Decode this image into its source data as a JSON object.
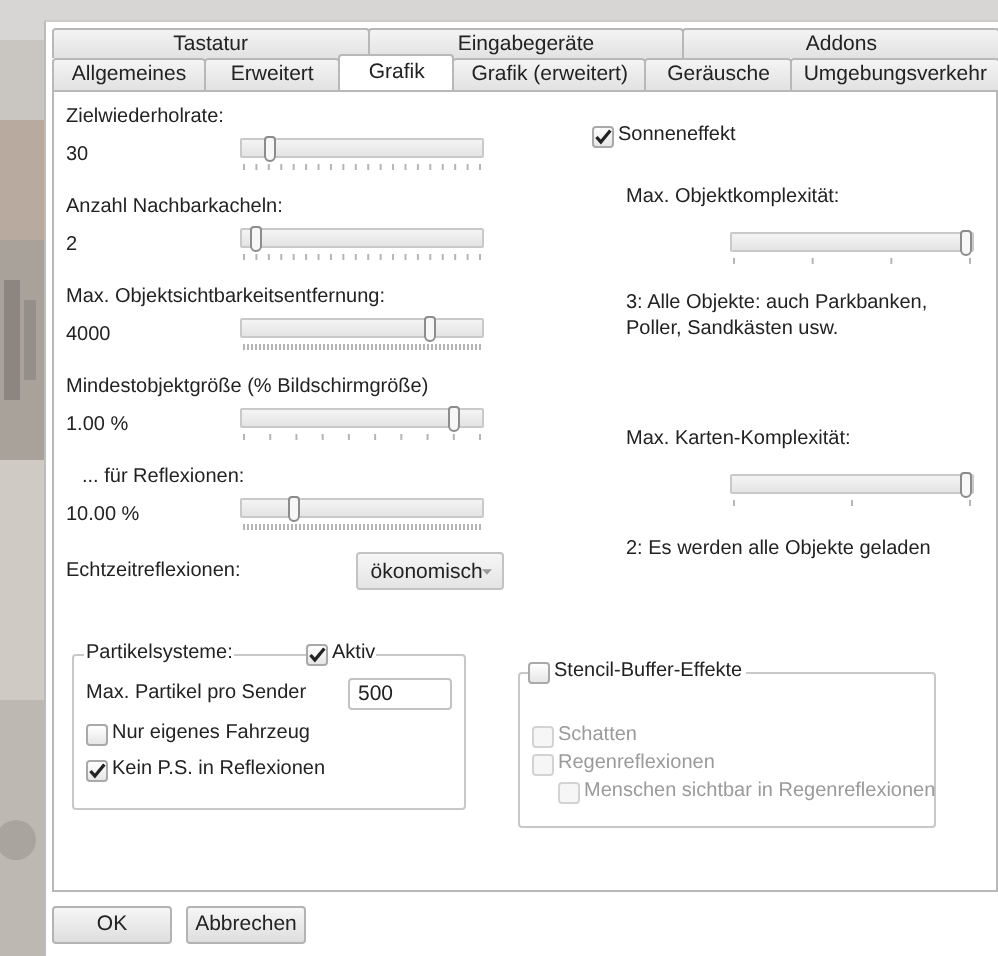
{
  "tabs_back": [
    {
      "label": "Tastatur",
      "selected": false
    },
    {
      "label": "Eingabegeräte",
      "selected": false
    },
    {
      "label": "Addons",
      "selected": false
    }
  ],
  "tabs_front": [
    {
      "label": "Allgemeines",
      "selected": false
    },
    {
      "label": "Erweitert",
      "selected": false
    },
    {
      "label": "Grafik",
      "selected": true
    },
    {
      "label": "Grafik (erweitert)",
      "selected": false
    },
    {
      "label": "Geräusche",
      "selected": false
    },
    {
      "label": "Umgebungsverkehr",
      "selected": false
    }
  ],
  "left_sliders": [
    {
      "label": "Zielwiederholrate:",
      "value": "30",
      "level": 0.12
    },
    {
      "label": "Anzahl Nachbarkacheln:",
      "value": "2",
      "level": 0.06
    },
    {
      "label": "Max. Objektsichtbarkeitsentfernung:",
      "value": "4000",
      "level": 0.78
    },
    {
      "label": "Mindestobjektgröße (% Bildschirmgröße)",
      "value": "1.00 %",
      "level": 0.88
    },
    {
      "label": "... für Reflexionen:",
      "value": "10.00 %",
      "level": 0.22
    }
  ],
  "realtime_reflections": {
    "label": "Echtzeitreflexionen:",
    "value": "ökonomisch"
  },
  "sun_effect": {
    "label": "Sonneneffekt",
    "checked": true
  },
  "right_sliders": [
    {
      "label": "Max. Objektkomplexität:",
      "level": 1,
      "description": "3: Alle Objekte: auch Parkbanken, Poller, Sandkästen usw."
    },
    {
      "label": "Max. Karten-Komplexität:",
      "level": 1,
      "description": "2: Es werden alle Objekte geladen"
    }
  ],
  "particles": {
    "title": "Partikelsysteme:",
    "active": {
      "label": "Aktiv",
      "checked": true
    },
    "max_label": "Max. Partikel pro Sender",
    "max_value": "500",
    "options": [
      {
        "label": "Nur eigenes Fahrzeug",
        "checked": false
      },
      {
        "label": "Kein P.S. in Reflexionen",
        "checked": true
      }
    ]
  },
  "stencil": {
    "label": "Stencil-Buffer-Effekte",
    "checked": false,
    "options": [
      {
        "label": "Schatten",
        "checked": false,
        "disabled": true
      },
      {
        "label": "Regenreflexionen",
        "checked": false,
        "disabled": true,
        "children": [
          {
            "label": "Menschen sichtbar in Regenreflexionen",
            "checked": false,
            "disabled": true
          }
        ]
      }
    ]
  },
  "buttons": [
    "OK",
    "Abbrechen"
  ]
}
